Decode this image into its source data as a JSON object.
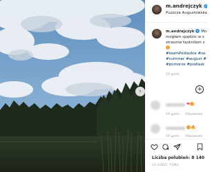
{
  "post": {
    "username": "m.andrejczyk",
    "location": "Puszcza Augustowska",
    "verified": true
  },
  "caption": {
    "username": "m.andrejczyk",
    "line1_tail": "Mn",
    "line2": "mogłam spędzić w s",
    "line3": "straszne tęskniłam z",
    "hashtags_line1": "#teamPodlaskie #sa",
    "hashtags_line2": "#summer #august #",
    "hashtags_line3": "#pomorze #podlask",
    "time": "19 godz."
  },
  "comments": [
    {
      "time": "19 godz.",
      "reply": "Odpowiedz",
      "icons": [
        "heart-icon",
        "emoji-icon"
      ]
    },
    {
      "time": "19 godz.",
      "reply": "Odpowiedz",
      "icons": [
        "emoji-icon",
        "fire-icon"
      ]
    }
  ],
  "load_more_symbol": "+",
  "actions": {
    "icons": [
      "heart-outline-icon",
      "comment-icon",
      "share-icon",
      "bookmark-icon"
    ],
    "likes": "Liczba polubień: 8 140",
    "post_time": "19 GODZ. TEMU"
  },
  "carousel_next_symbol": "›",
  "colors": {
    "hashtag": "#003569",
    "verified": "#3897f0",
    "like_heart": "#ed4956"
  }
}
